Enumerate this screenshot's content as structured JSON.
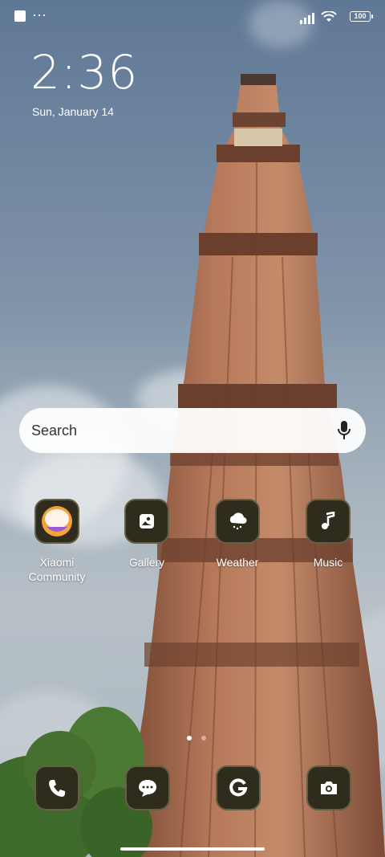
{
  "status_bar": {
    "battery": "100"
  },
  "lockclock": {
    "time": "2:36",
    "date": "Sun, January 14"
  },
  "search": {
    "placeholder": "Search"
  },
  "apps": [
    {
      "label": "Xiaomi\nCommunity",
      "icon": "xiaomi-community-icon"
    },
    {
      "label": "Gallery",
      "icon": "gallery-icon"
    },
    {
      "label": "Weather",
      "icon": "weather-icon"
    },
    {
      "label": "Music",
      "icon": "music-icon"
    }
  ],
  "dock": [
    {
      "icon": "phone-icon"
    },
    {
      "icon": "messages-icon"
    },
    {
      "icon": "google-icon"
    },
    {
      "icon": "camera-icon"
    }
  ],
  "pager": {
    "pages": 2,
    "current": 1
  }
}
